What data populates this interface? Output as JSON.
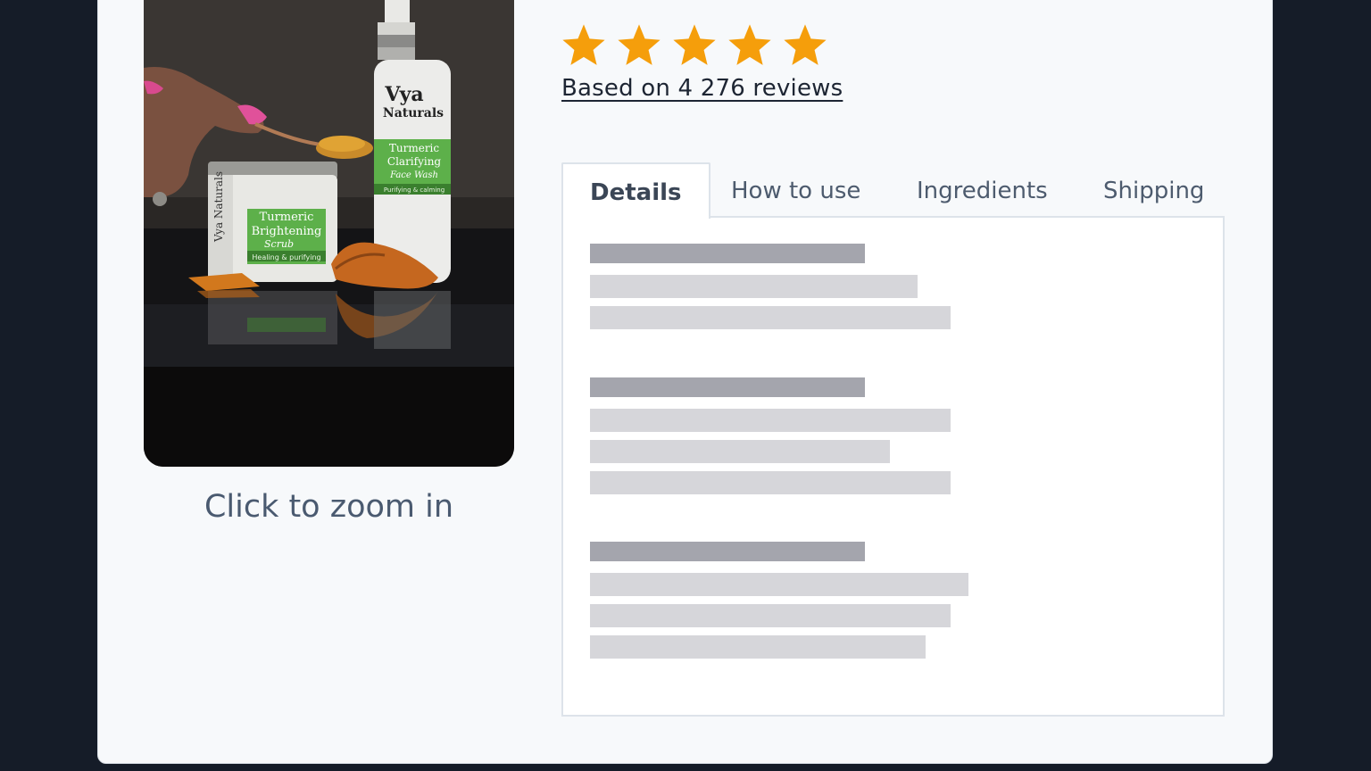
{
  "product": {
    "zoom_caption": "Click to zoom in",
    "image": {
      "jar_brand": "Vya Naturals",
      "jar_label_line1": "Turmeric",
      "jar_label_line2": "Brightening",
      "jar_label_line3": "Scrub",
      "jar_label_line4": "Healing & purifying",
      "bottle_brand_line1": "Vya",
      "bottle_brand_line2": "Naturals",
      "bottle_label_line1": "Turmeric",
      "bottle_label_line2": "Clarifying",
      "bottle_label_line3": "Face Wash",
      "bottle_label_line4": "Purifying & calming"
    }
  },
  "rating": {
    "stars": 5,
    "max_stars": 5,
    "star_color": "#f59e0b",
    "reviews_text": "Based on 4 276 reviews"
  },
  "tabs": [
    {
      "label": "Details",
      "active": true
    },
    {
      "label": "How to use",
      "active": false
    },
    {
      "label": "Ingredients",
      "active": false
    },
    {
      "label": "Shipping",
      "active": false
    }
  ],
  "colors": {
    "background": "#151c28",
    "card": "#f7f9fb",
    "skeleton_heading": "#a4a5ad",
    "skeleton_line": "#d6d6da"
  }
}
